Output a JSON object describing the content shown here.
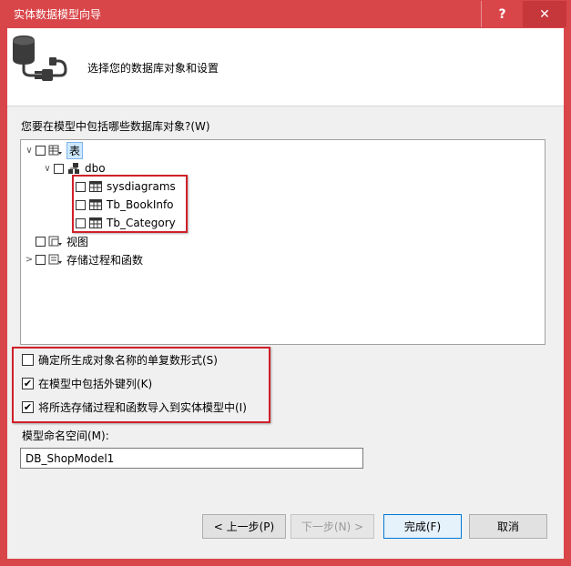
{
  "window": {
    "title": "实体数据模型向导",
    "help_label": "?",
    "close_label": "✕"
  },
  "header": {
    "text": "选择您的数据库对象和设置"
  },
  "question": "您要在模型中包括哪些数据库对象?(W)",
  "tree": {
    "tables_label": "表",
    "schema_label": "dbo",
    "tables": [
      "sysdiagrams",
      "Tb_BookInfo",
      "Tb_Category"
    ],
    "views_label": "视图",
    "procs_label": "存储过程和函数"
  },
  "options": [
    {
      "label": "确定所生成对象名称的单复数形式(S)",
      "checked": false
    },
    {
      "label": "在模型中包括外键列(K)",
      "checked": true
    },
    {
      "label": "将所选存储过程和函数导入到实体模型中(I)",
      "checked": true
    }
  ],
  "namespace": {
    "label": "模型命名空间(M):",
    "value": "DB_ShopModel1"
  },
  "buttons": {
    "prev": "< 上一步(P)",
    "next": "下一步(N) >",
    "finish": "完成(F)",
    "cancel": "取消"
  },
  "colors": {
    "title_bar": "#d9464a",
    "highlight_box": "#d0202a",
    "selection": "#cde8ff"
  }
}
